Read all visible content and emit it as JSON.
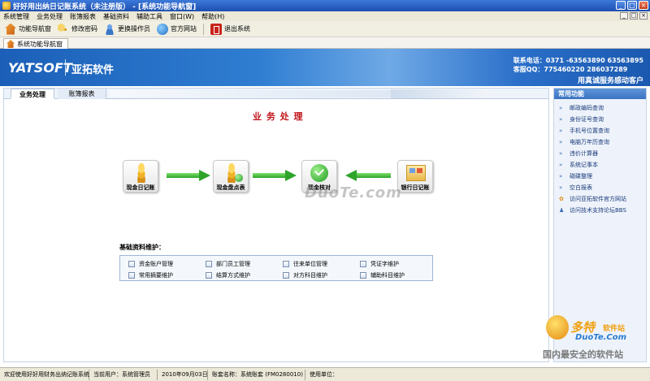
{
  "window": {
    "title": "好好用出纳日记账系统（未注册版） - [系统功能导航窗]"
  },
  "menu": [
    "系统管理",
    "业务处理",
    "账簿报表",
    "基础资料",
    "辅助工具",
    "窗口(W)",
    "帮助(H)"
  ],
  "toolbar": {
    "nav": "功能导航窗",
    "password": "修改密码",
    "operator": "更换操作员",
    "website": "官方网站",
    "exit": "退出系统"
  },
  "doc_tab": "系统功能导航窗",
  "banner": {
    "logo": "YATSOFT",
    "brand": "亚拓软件",
    "phone": "联系电话：0371 -63563890   63563895",
    "qq": "客服QQ：775460220   286037289",
    "slogan": "用真诚服务感动客户"
  },
  "content": {
    "tabs": [
      "业务处理",
      "账簿报表"
    ],
    "section_title": "业 务 处 理",
    "flow": {
      "cash_journal": "现金日记账",
      "cash_check": "现金盘点表",
      "verify": "现金核对",
      "bank_journal": "银行日记账"
    },
    "watermark": "DuoTe.com",
    "basic_title": "基础资料维护：",
    "basic_items": [
      "资金账户管理",
      "部门员工管理",
      "往来单位管理",
      "凭证字维护",
      "常用摘要维护",
      "结算方式维护",
      "对方科目维护",
      "辅助科目维护"
    ]
  },
  "side": {
    "header": "常用功能",
    "items": [
      "邮政编码查询",
      "身份证号查询",
      "手机号位置查询",
      "电脑万年历查询",
      "违价计算器",
      "系统记事本",
      "磁碟整理",
      "空白报表",
      "访问亚拓软件官方网站",
      "访问技术支持论坛BBS"
    ]
  },
  "watermark_br": {
    "line1": "多特",
    "line1b": "软件站",
    "line2": "DuoTe.Com",
    "line3": "国内最安全的软件站"
  },
  "status": {
    "welcome": "欢迎使用好好用财务出纳记账系统",
    "user": "当前用户：系统管理员",
    "date": "2010年09月03日",
    "book": "账套名称：系统账套 (FM0280010)",
    "unit": "使用单位："
  }
}
